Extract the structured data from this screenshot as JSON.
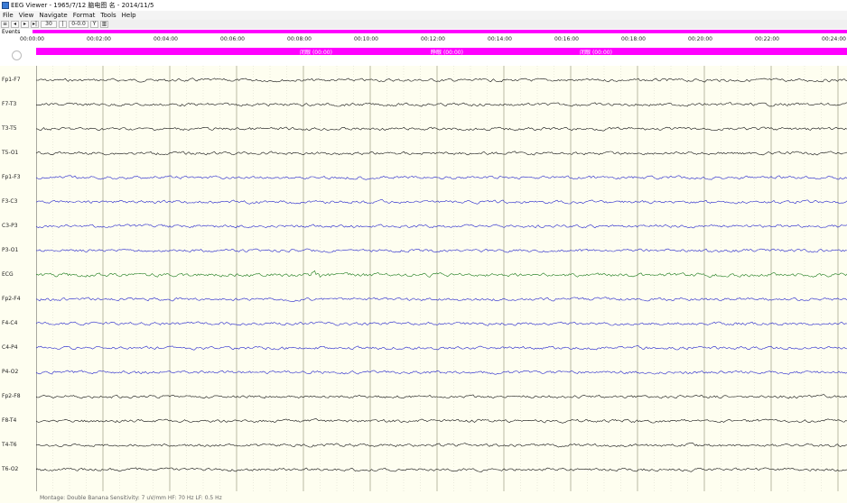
{
  "window": {
    "title": "EEG Viewer - 1965/7/12 脑电图 名 - 2014/11/5"
  },
  "menu": [
    "File",
    "View",
    "Navigate",
    "Format",
    "Tools",
    "Help"
  ],
  "toolbar": {
    "speed_value": "30",
    "filter_value": "0-0.0",
    "items": [
      "≡",
      "◂",
      "▸",
      "▸|",
      "|",
      "Y",
      "▥"
    ]
  },
  "events": {
    "label": "Events",
    "color": "#ff00ff"
  },
  "time_axis": {
    "ticks": [
      "00:00:00",
      "00:02:00",
      "00:04:00",
      "00:06:00",
      "00:08:00",
      "00:10:00",
      "00:12:00",
      "00:14:00",
      "00:16:00",
      "00:18:00",
      "00:20:00",
      "00:22:00",
      "00:24:00"
    ]
  },
  "annotation_band": {
    "labels": [
      "闭眼 (00:00)",
      "睁眼 (00:00)",
      "闭眼 (00:00)"
    ],
    "color": "#ff00ff"
  },
  "channels": [
    {
      "label": "Fp1-F7",
      "color": "#111111"
    },
    {
      "label": "F7-T3",
      "color": "#111111"
    },
    {
      "label": "T3-T5",
      "color": "#111111"
    },
    {
      "label": "T5-O1",
      "color": "#111111"
    },
    {
      "label": "Fp1-F3",
      "color": "#2222cc"
    },
    {
      "label": "F3-C3",
      "color": "#2222cc"
    },
    {
      "label": "C3-P3",
      "color": "#2222cc"
    },
    {
      "label": "P3-O1",
      "color": "#2222cc"
    },
    {
      "label": "ECG",
      "color": "#1a7a1a"
    },
    {
      "label": "Fp2-F4",
      "color": "#2222cc"
    },
    {
      "label": "F4-C4",
      "color": "#2222cc"
    },
    {
      "label": "C4-P4",
      "color": "#2222cc"
    },
    {
      "label": "P4-O2",
      "color": "#2222cc"
    },
    {
      "label": "Fp2-F8",
      "color": "#111111"
    },
    {
      "label": "F8-T4",
      "color": "#111111"
    },
    {
      "label": "T4-T6",
      "color": "#111111"
    },
    {
      "label": "T6-O2",
      "color": "#111111"
    }
  ],
  "colors": {
    "background": "#fefef0",
    "gridline": "#c0c0b0",
    "accent": "#ff00ff"
  },
  "status": {
    "text": "Montage: Double Banana   Sensitivity: 7 uV/mm   HF: 70 Hz   LF: 0.5 Hz"
  }
}
